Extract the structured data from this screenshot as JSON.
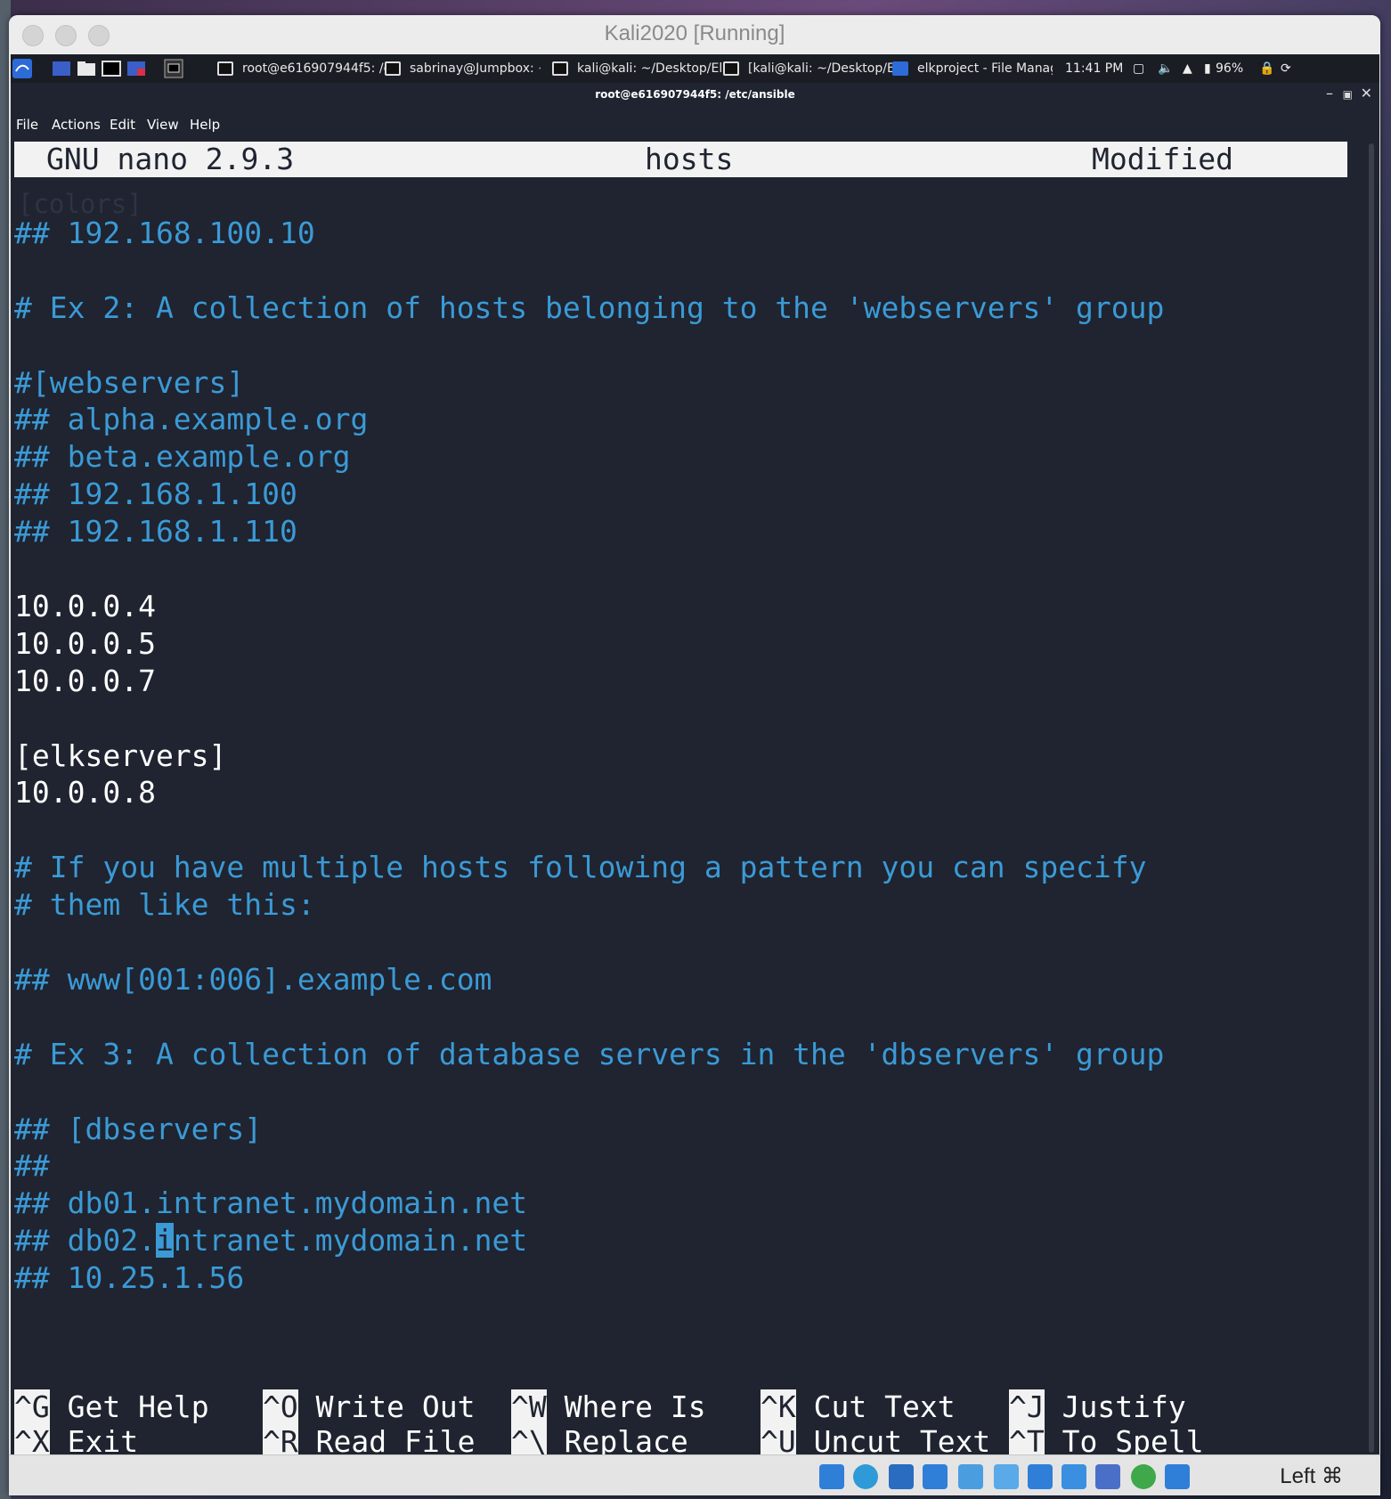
{
  "vm": {
    "title": "Kali2020 [Running]",
    "host_key": "Left ⌘"
  },
  "panel": {
    "tasks": [
      "root@e616907944f5: /e...",
      "sabrinay@Jumpbox: ~",
      "kali@kali: ~/Desktop/Elk...",
      "[kali@kali: ~/Desktop/El...",
      "elkproject - File Manager"
    ],
    "clock": "11:41 PM",
    "battery": "96%"
  },
  "window": {
    "title": "root@e616907944f5: /etc/ansible"
  },
  "menu": [
    "File",
    "Actions",
    "Edit",
    "View",
    "Help"
  ],
  "nano": {
    "version": "GNU nano 2.9.3",
    "filename": "hosts",
    "status": "Modified"
  },
  "lines": [
    {
      "text": "",
      "color": "white"
    },
    {
      "text": "## 192.168.100.10",
      "color": "blue"
    },
    {
      "text": "",
      "color": "white"
    },
    {
      "text": "# Ex 2: A collection of hosts belonging to the 'webservers' group",
      "color": "blue"
    },
    {
      "text": "",
      "color": "white"
    },
    {
      "text": "#[webservers]",
      "color": "blue"
    },
    {
      "text": "## alpha.example.org",
      "color": "blue"
    },
    {
      "text": "## beta.example.org",
      "color": "blue"
    },
    {
      "text": "## 192.168.1.100",
      "color": "blue"
    },
    {
      "text": "## 192.168.1.110",
      "color": "blue"
    },
    {
      "text": "",
      "color": "white"
    },
    {
      "text": "10.0.0.4",
      "color": "white"
    },
    {
      "text": "10.0.0.5",
      "color": "white"
    },
    {
      "text": "10.0.0.7",
      "color": "white"
    },
    {
      "text": "",
      "color": "white"
    },
    {
      "text": "[elkservers]",
      "color": "white"
    },
    {
      "text": "10.0.0.8",
      "color": "white"
    },
    {
      "text": "",
      "color": "white"
    },
    {
      "text": "# If you have multiple hosts following a pattern you can specify",
      "color": "blue"
    },
    {
      "text": "# them like this:",
      "color": "blue"
    },
    {
      "text": "",
      "color": "white"
    },
    {
      "text": "## www[001:006].example.com",
      "color": "blue"
    },
    {
      "text": "",
      "color": "white"
    },
    {
      "text": "# Ex 3: A collection of database servers in the 'dbservers' group",
      "color": "blue"
    },
    {
      "text": "",
      "color": "white"
    },
    {
      "text": "## [dbservers]",
      "color": "blue"
    },
    {
      "text": "##",
      "color": "blue"
    },
    {
      "text": "## db01.intranet.mydomain.net",
      "color": "blue"
    },
    {
      "text": "## db02.intranet.mydomain.net",
      "color": "blue"
    },
    {
      "text": "## 10.25.1.56",
      "color": "blue"
    }
  ],
  "cursor_line": 28,
  "cursor_col": 8,
  "shortcuts": [
    [
      {
        "key": "^G",
        "label": "Get Help"
      },
      {
        "key": "^X",
        "label": "Exit"
      }
    ],
    [
      {
        "key": "^O",
        "label": "Write Out"
      },
      {
        "key": "^R",
        "label": "Read File"
      }
    ],
    [
      {
        "key": "^W",
        "label": "Where Is"
      },
      {
        "key": "^\\",
        "label": "Replace"
      }
    ],
    [
      {
        "key": "^K",
        "label": "Cut Text"
      },
      {
        "key": "^U",
        "label": "Uncut Text"
      }
    ],
    [
      {
        "key": "^J",
        "label": "Justify"
      },
      {
        "key": "^T",
        "label": "To Spell"
      }
    ]
  ],
  "colors": {
    "terminal_bg": "#1f2430",
    "comment_blue": "#3b9ad6",
    "text_white": "#ffffff"
  }
}
